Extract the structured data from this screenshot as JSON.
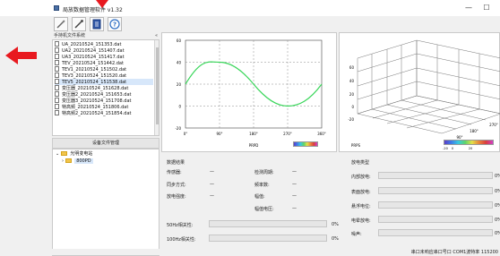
{
  "window": {
    "title": "局放数据管理软件 v1.32",
    "minimize": "—",
    "maximize": "☐"
  },
  "toolbar": {
    "buttons": [
      {
        "name": "tool-1-button",
        "icon": "pen-icon"
      },
      {
        "name": "tool-2-button",
        "icon": "wand-icon"
      },
      {
        "name": "tool-3-button",
        "icon": "document-icon"
      },
      {
        "name": "help-button",
        "icon": "help-icon",
        "label": "?"
      }
    ]
  },
  "left_panel": {
    "header": "手持机文件系统",
    "close": "«",
    "files": [
      "UA_20210524_151353.dat",
      "UA2_20210524_151407.dat",
      "UA3_20210524_151417.dat",
      "TEV_20210524_151442.dat",
      "TEV1_20210524_151502.dat",
      "TEV3_20210524_151520.dat",
      "TEV5_20210524_151538.dat",
      "变压器_20210524_151628.dat",
      "变压器2_20210524_151653.dat",
      "变压器3_20210524_151708.dat",
      "特高频_20210524_151806.dat",
      "特高频2_20210524_151854.dat"
    ],
    "selected_index": 6,
    "device_header": "设备文件管理",
    "tree": [
      {
        "label": "光明变电站",
        "level": 0
      },
      {
        "label": "800PD",
        "level": 1
      }
    ]
  },
  "chart2d": {
    "y_ticks": [
      "60",
      "40",
      "20",
      "0",
      "-20"
    ],
    "x_ticks": [
      "0°",
      "90°",
      "180°",
      "270°",
      "360°"
    ],
    "prpd_label": "PRPD"
  },
  "chart3d": {
    "z_ticks": [
      "60",
      "40",
      "20",
      "0",
      "-20"
    ],
    "axis_labels": [
      "270°",
      "180°",
      "90°",
      "0°"
    ],
    "prps_label": "PRPS",
    "colorbar_ticks": [
      "-20",
      "0",
      "20"
    ]
  },
  "data_section": {
    "title": "数据结果",
    "rows": [
      {
        "label": "传感器:",
        "value": "—",
        "label2": "检测周期:",
        "value2": "—"
      },
      {
        "label": "同步方式:",
        "value": "—",
        "label2": "频率数:",
        "value2": "—"
      },
      {
        "label": "放电强度:",
        "value": "—",
        "label2": "幅值:",
        "value2": "—"
      },
      {
        "label": "",
        "value": "",
        "label2": "幅值电压:",
        "value2": "—"
      }
    ],
    "progress": [
      {
        "label": "50Hz相关性:",
        "pct": "0%"
      },
      {
        "label": "100Hz相关性:",
        "pct": "0%"
      }
    ]
  },
  "discharge_type": {
    "title": "放电类型",
    "items": [
      {
        "label": "内部放电:",
        "value": "0%"
      },
      {
        "label": "表面放电:",
        "value": "0%"
      },
      {
        "label": "悬浮电位:",
        "value": "0%"
      },
      {
        "label": "电晕放电:",
        "value": "0%"
      },
      {
        "label": "噪声:",
        "value": "0%"
      }
    ]
  },
  "status": {
    "text": "串口未响应串口号口 COM1波特率 115200"
  }
}
